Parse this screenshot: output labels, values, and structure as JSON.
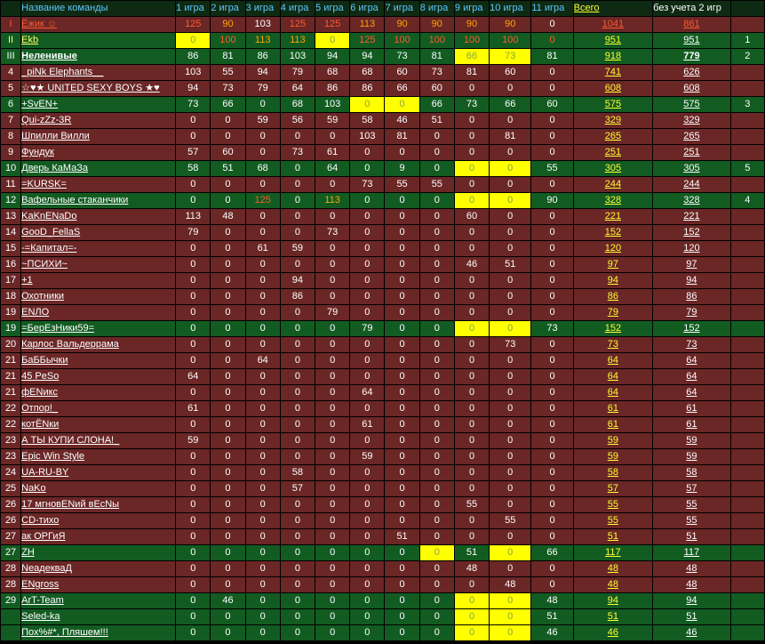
{
  "header": {
    "place": "",
    "team": "Название команды",
    "games": [
      "1 игра",
      "2 игра",
      "3 игра",
      "4 игра",
      "5 игра",
      "6 игра",
      "7 игра",
      "8 игра",
      "9 игра",
      "10 игра",
      "11 игра"
    ],
    "total": "Всего",
    "without_game2": "без учета 2 игр",
    "extra": ""
  },
  "colors": {
    "row_green": "#125c22",
    "row_red": "#6b2626",
    "highlight": "#ffff00",
    "header_text": "#5bc8ff",
    "total_text": "#ffff33"
  },
  "rows": [
    {
      "place": "I",
      "team": "Ёжик ☺",
      "scores": [
        "125",
        "90",
        "103",
        "125",
        "125",
        "113",
        "90",
        "90",
        "90",
        "90",
        "0"
      ],
      "total": "1041",
      "nog2": "861",
      "extra": "",
      "style": "red",
      "hl": [],
      "cellColors": {
        "0": "col-red",
        "1": "col-orange",
        "3": "col-red",
        "4": "col-red",
        "5": "col-orange",
        "6": "col-orange",
        "7": "col-orange",
        "8": "col-orange",
        "9": "col-orange"
      },
      "teamColor": "col-red",
      "totalColor": "col-red",
      "nog2Color": "col-red",
      "placeColor": "col-red"
    },
    {
      "place": "II",
      "team": "Ekb",
      "scores": [
        "0",
        "100",
        "113",
        "113",
        "0",
        "125",
        "100",
        "100",
        "100",
        "100",
        "0"
      ],
      "total": "951",
      "nog2": "951",
      "extra": "1",
      "style": "green",
      "hl": [
        0,
        4
      ],
      "cellColors": {
        "1": "col-red",
        "2": "col-orange",
        "3": "col-orange",
        "5": "col-red",
        "6": "col-red",
        "7": "col-red",
        "8": "col-red",
        "9": "col-red",
        "10": "col-red"
      },
      "teamColor": "col-yellow",
      "placeColor": "col-yellow"
    },
    {
      "place": "III",
      "team": "Неленивые",
      "scores": [
        "86",
        "81",
        "86",
        "103",
        "94",
        "94",
        "73",
        "81",
        "66",
        "73",
        "81"
      ],
      "total": "918",
      "nog2": "779",
      "extra": "2",
      "style": "green",
      "hl": [
        8,
        9
      ],
      "cellColors": {},
      "bold": true
    },
    {
      "place": "4",
      "team": "_piNk Elephants__",
      "scores": [
        "103",
        "55",
        "94",
        "79",
        "68",
        "68",
        "60",
        "73",
        "81",
        "60",
        "0"
      ],
      "total": "741",
      "nog2": "626",
      "extra": "",
      "style": "red",
      "hl": [],
      "cellColors": {}
    },
    {
      "place": "5",
      "team": "☆♥★ UNITED SEXY BOYS ★♥",
      "scores": [
        "94",
        "73",
        "79",
        "64",
        "86",
        "86",
        "66",
        "60",
        "0",
        "0",
        "0"
      ],
      "total": "608",
      "nog2": "608",
      "extra": "",
      "style": "red",
      "hl": [],
      "cellColors": {}
    },
    {
      "place": "6",
      "team": "+SvEN+",
      "scores": [
        "73",
        "66",
        "0",
        "68",
        "103",
        "0",
        "0",
        "66",
        "73",
        "66",
        "60"
      ],
      "total": "575",
      "nog2": "575",
      "extra": "3",
      "style": "green",
      "hl": [
        5,
        6
      ],
      "cellColors": {}
    },
    {
      "place": "7",
      "team": "Qui-zZz-3R",
      "scores": [
        "0",
        "0",
        "59",
        "56",
        "59",
        "58",
        "46",
        "51",
        "0",
        "0",
        "0"
      ],
      "total": "329",
      "nog2": "329",
      "extra": "",
      "style": "red",
      "hl": [],
      "cellColors": {}
    },
    {
      "place": "8",
      "team": "Шпилли Вилли",
      "scores": [
        "0",
        "0",
        "0",
        "0",
        "0",
        "103",
        "81",
        "0",
        "0",
        "81",
        "0"
      ],
      "total": "265",
      "nog2": "265",
      "extra": "",
      "style": "red",
      "hl": [],
      "cellColors": {}
    },
    {
      "place": "9",
      "team": "Фундук",
      "scores": [
        "57",
        "60",
        "0",
        "73",
        "61",
        "0",
        "0",
        "0",
        "0",
        "0",
        "0"
      ],
      "total": "251",
      "nog2": "251",
      "extra": "",
      "style": "red",
      "hl": [],
      "cellColors": {}
    },
    {
      "place": "10",
      "team": "Дверь КаМаЗа",
      "scores": [
        "58",
        "51",
        "68",
        "0",
        "64",
        "0",
        "9",
        "0",
        "0",
        "0",
        "55"
      ],
      "total": "305",
      "nog2": "305",
      "extra": "5",
      "style": "green",
      "hl": [
        8,
        9
      ],
      "cellColors": {}
    },
    {
      "place": "11",
      "team": "=KURSK=",
      "scores": [
        "0",
        "0",
        "0",
        "0",
        "0",
        "73",
        "55",
        "55",
        "0",
        "0",
        "0"
      ],
      "total": "244",
      "nog2": "244",
      "extra": "",
      "style": "red",
      "hl": [],
      "cellColors": {}
    },
    {
      "place": "12",
      "team": "Вафельные стаканчики",
      "scores": [
        "0",
        "0",
        "125",
        "0",
        "113",
        "0",
        "0",
        "0",
        "0",
        "0",
        "90"
      ],
      "total": "328",
      "nog2": "328",
      "extra": "4",
      "style": "green",
      "hl": [
        8,
        9
      ],
      "cellColors": {
        "2": "col-red",
        "4": "col-orange"
      }
    },
    {
      "place": "13",
      "team": "KaKnENaDo",
      "scores": [
        "113",
        "48",
        "0",
        "0",
        "0",
        "0",
        "0",
        "0",
        "60",
        "0",
        "0"
      ],
      "total": "221",
      "nog2": "221",
      "extra": "",
      "style": "red",
      "hl": [],
      "cellColors": {}
    },
    {
      "place": "14",
      "team": "GooD_FellaS",
      "scores": [
        "79",
        "0",
        "0",
        "0",
        "73",
        "0",
        "0",
        "0",
        "0",
        "0",
        "0"
      ],
      "total": "152",
      "nog2": "152",
      "extra": "",
      "style": "red",
      "hl": [],
      "cellColors": {}
    },
    {
      "place": "15",
      "team": "-=Капитал=-",
      "scores": [
        "0",
        "0",
        "61",
        "59",
        "0",
        "0",
        "0",
        "0",
        "0",
        "0",
        "0"
      ],
      "total": "120",
      "nog2": "120",
      "extra": "",
      "style": "red",
      "hl": [],
      "cellColors": {}
    },
    {
      "place": "16",
      "team": "~ПСИХИ~",
      "scores": [
        "0",
        "0",
        "0",
        "0",
        "0",
        "0",
        "0",
        "0",
        "46",
        "51",
        "0"
      ],
      "total": "97",
      "nog2": "97",
      "extra": "",
      "style": "red",
      "hl": [],
      "cellColors": {}
    },
    {
      "place": "17",
      "team": "+1",
      "scores": [
        "0",
        "0",
        "0",
        "94",
        "0",
        "0",
        "0",
        "0",
        "0",
        "0",
        "0"
      ],
      "total": "94",
      "nog2": "94",
      "extra": "",
      "style": "red",
      "hl": [],
      "cellColors": {}
    },
    {
      "place": "18",
      "team": "Охотники",
      "scores": [
        "0",
        "0",
        "0",
        "86",
        "0",
        "0",
        "0",
        "0",
        "0",
        "0",
        "0"
      ],
      "total": "86",
      "nog2": "86",
      "extra": "",
      "style": "red",
      "hl": [],
      "cellColors": {}
    },
    {
      "place": "19",
      "team": "ENЛО",
      "scores": [
        "0",
        "0",
        "0",
        "0",
        "79",
        "0",
        "0",
        "0",
        "0",
        "0",
        "0"
      ],
      "total": "79",
      "nog2": "79",
      "extra": "",
      "style": "red",
      "hl": [],
      "cellColors": {}
    },
    {
      "place": "19",
      "team": "=БерЕзНики59=",
      "scores": [
        "0",
        "0",
        "0",
        "0",
        "0",
        "79",
        "0",
        "0",
        "0",
        "0",
        "73"
      ],
      "total": "152",
      "nog2": "152",
      "extra": "",
      "style": "green",
      "hl": [
        8,
        9
      ],
      "cellColors": {}
    },
    {
      "place": "20",
      "team": "Карлос Вальдеррама",
      "scores": [
        "0",
        "0",
        "0",
        "0",
        "0",
        "0",
        "0",
        "0",
        "0",
        "73",
        "0"
      ],
      "total": "73",
      "nog2": "73",
      "extra": "",
      "style": "red",
      "hl": [],
      "cellColors": {}
    },
    {
      "place": "21",
      "team": "БаББычки",
      "scores": [
        "0",
        "0",
        "64",
        "0",
        "0",
        "0",
        "0",
        "0",
        "0",
        "0",
        "0"
      ],
      "total": "64",
      "nog2": "64",
      "extra": "",
      "style": "red",
      "hl": [],
      "cellColors": {}
    },
    {
      "place": "21",
      "team": "45 PeSo",
      "scores": [
        "64",
        "0",
        "0",
        "0",
        "0",
        "0",
        "0",
        "0",
        "0",
        "0",
        "0"
      ],
      "total": "64",
      "nog2": "64",
      "extra": "",
      "style": "red",
      "hl": [],
      "cellColors": {}
    },
    {
      "place": "21",
      "team": "фЕNикс",
      "scores": [
        "0",
        "0",
        "0",
        "0",
        "0",
        "64",
        "0",
        "0",
        "0",
        "0",
        "0"
      ],
      "total": "64",
      "nog2": "64",
      "extra": "",
      "style": "red",
      "hl": [],
      "cellColors": {}
    },
    {
      "place": "22",
      "team": "Отпор!_",
      "scores": [
        "61",
        "0",
        "0",
        "0",
        "0",
        "0",
        "0",
        "0",
        "0",
        "0",
        "0"
      ],
      "total": "61",
      "nog2": "61",
      "extra": "",
      "style": "red",
      "hl": [],
      "cellColors": {}
    },
    {
      "place": "22",
      "team": "котЁNки",
      "scores": [
        "0",
        "0",
        "0",
        "0",
        "0",
        "61",
        "0",
        "0",
        "0",
        "0",
        "0"
      ],
      "total": "61",
      "nog2": "61",
      "extra": "",
      "style": "red",
      "hl": [],
      "cellColors": {}
    },
    {
      "place": "23",
      "team": "А ТЫ КУПИ СЛОНА!_",
      "scores": [
        "59",
        "0",
        "0",
        "0",
        "0",
        "0",
        "0",
        "0",
        "0",
        "0",
        "0"
      ],
      "total": "59",
      "nog2": "59",
      "extra": "",
      "style": "red",
      "hl": [],
      "cellColors": {}
    },
    {
      "place": "23",
      "team": "Epic Win Style",
      "scores": [
        "0",
        "0",
        "0",
        "0",
        "0",
        "59",
        "0",
        "0",
        "0",
        "0",
        "0"
      ],
      "total": "59",
      "nog2": "59",
      "extra": "",
      "style": "red",
      "hl": [],
      "cellColors": {}
    },
    {
      "place": "24",
      "team": "UA-RU-BY",
      "scores": [
        "0",
        "0",
        "0",
        "58",
        "0",
        "0",
        "0",
        "0",
        "0",
        "0",
        "0"
      ],
      "total": "58",
      "nog2": "58",
      "extra": "",
      "style": "red",
      "hl": [],
      "cellColors": {}
    },
    {
      "place": "25",
      "team": "NaKo",
      "scores": [
        "0",
        "0",
        "0",
        "57",
        "0",
        "0",
        "0",
        "0",
        "0",
        "0",
        "0"
      ],
      "total": "57",
      "nog2": "57",
      "extra": "",
      "style": "red",
      "hl": [],
      "cellColors": {}
    },
    {
      "place": "26",
      "team": "17 мгновЕNий вЕсNы",
      "scores": [
        "0",
        "0",
        "0",
        "0",
        "0",
        "0",
        "0",
        "0",
        "55",
        "0",
        "0"
      ],
      "total": "55",
      "nog2": "55",
      "extra": "",
      "style": "red",
      "hl": [],
      "cellColors": {}
    },
    {
      "place": "26",
      "team": "CD-тихо",
      "scores": [
        "0",
        "0",
        "0",
        "0",
        "0",
        "0",
        "0",
        "0",
        "0",
        "55",
        "0"
      ],
      "total": "55",
      "nog2": "55",
      "extra": "",
      "style": "red",
      "hl": [],
      "cellColors": {}
    },
    {
      "place": "27",
      "team": "ак ОРГиЯ",
      "scores": [
        "0",
        "0",
        "0",
        "0",
        "0",
        "0",
        "51",
        "0",
        "0",
        "0",
        "0"
      ],
      "total": "51",
      "nog2": "51",
      "extra": "",
      "style": "red",
      "hl": [],
      "cellColors": {}
    },
    {
      "place": "27",
      "team": "ZH",
      "scores": [
        "0",
        "0",
        "0",
        "0",
        "0",
        "0",
        "0",
        "0",
        "51",
        "0",
        "66"
      ],
      "total": "117",
      "nog2": "117",
      "extra": "",
      "style": "green",
      "hl": [
        7,
        9
      ],
      "cellColors": {}
    },
    {
      "place": "28",
      "team": "NeадекваД",
      "scores": [
        "0",
        "0",
        "0",
        "0",
        "0",
        "0",
        "0",
        "0",
        "48",
        "0",
        "0"
      ],
      "total": "48",
      "nog2": "48",
      "extra": "",
      "style": "red",
      "hl": [],
      "cellColors": {}
    },
    {
      "place": "28",
      "team": "ENgross",
      "scores": [
        "0",
        "0",
        "0",
        "0",
        "0",
        "0",
        "0",
        "0",
        "0",
        "48",
        "0"
      ],
      "total": "48",
      "nog2": "48",
      "extra": "",
      "style": "red",
      "hl": [],
      "cellColors": {}
    },
    {
      "place": "29",
      "team": "ArT-Team",
      "scores": [
        "0",
        "46",
        "0",
        "0",
        "0",
        "0",
        "0",
        "0",
        "0",
        "0",
        "48"
      ],
      "total": "94",
      "nog2": "94",
      "extra": "",
      "style": "green",
      "hl": [
        8,
        9
      ],
      "cellColors": {}
    },
    {
      "place": "",
      "team": "Seled-ka",
      "scores": [
        "0",
        "0",
        "0",
        "0",
        "0",
        "0",
        "0",
        "0",
        "0",
        "0",
        "51"
      ],
      "total": "51",
      "nog2": "51",
      "extra": "",
      "style": "green",
      "hl": [
        8,
        9
      ],
      "cellColors": {}
    },
    {
      "place": "",
      "team": "Пох%#*, Пляшем!!!",
      "scores": [
        "0",
        "0",
        "0",
        "0",
        "0",
        "0",
        "0",
        "0",
        "0",
        "0",
        "46"
      ],
      "total": "46",
      "nog2": "46",
      "extra": "",
      "style": "green",
      "hl": [
        8,
        9
      ],
      "cellColors": {}
    }
  ]
}
